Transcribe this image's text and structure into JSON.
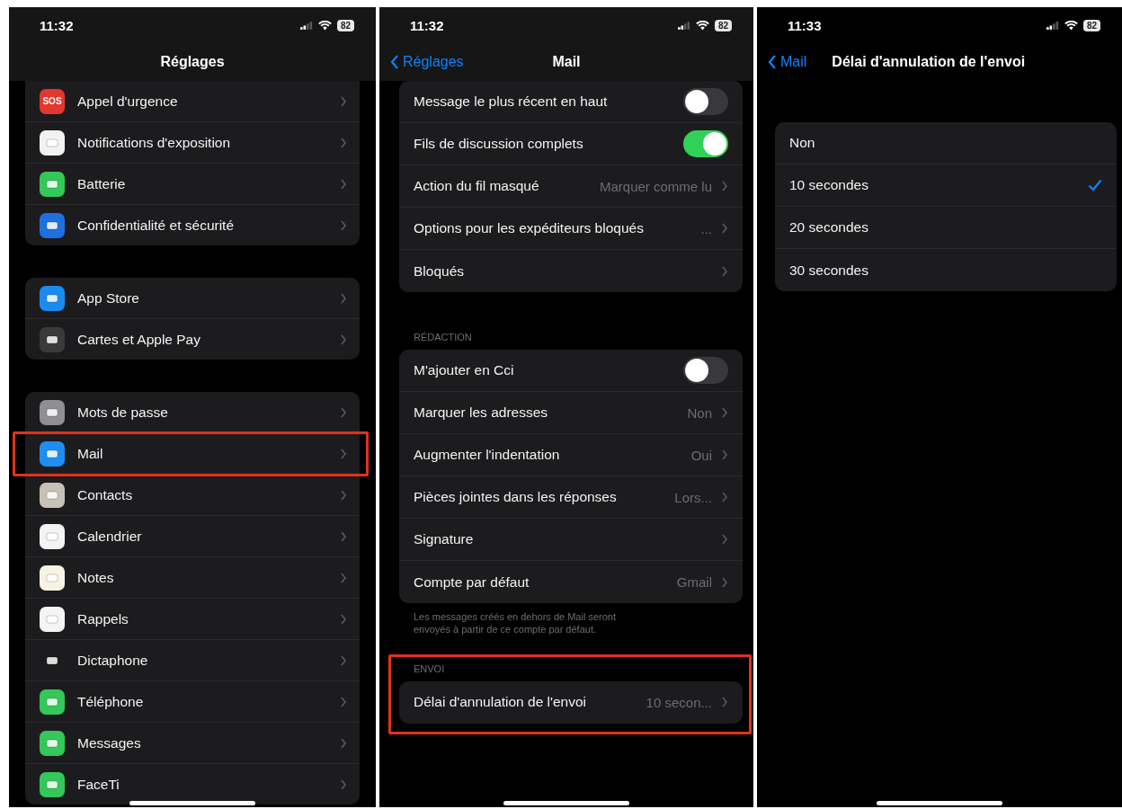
{
  "screens": [
    {
      "status": {
        "time": "11:32",
        "battery": "82"
      },
      "nav": {
        "title": "Réglages"
      },
      "groups": [
        {
          "items": [
            {
              "label": "Appel d'urgence",
              "color": "#e5372f",
              "icon_text": "SOS",
              "highlighted": false
            },
            {
              "label": "Notifications d'exposition",
              "color": "#f2f2f2",
              "highlighted": false
            },
            {
              "label": "Batterie",
              "color": "#34c759",
              "highlighted": false
            },
            {
              "label": "Confidentialité et sécurité",
              "color": "#1e6fe0",
              "highlighted": false
            }
          ]
        },
        {
          "items": [
            {
              "label": "App Store",
              "color": "#1a8cf0",
              "highlighted": false
            },
            {
              "label": "Cartes et Apple Pay",
              "color": "#3a3a3a",
              "highlighted": false
            }
          ]
        },
        {
          "items": [
            {
              "label": "Mots de passe",
              "color": "#8e8e93",
              "highlighted": false
            },
            {
              "label": "Mail",
              "color": "#1f8ef1",
              "highlighted": true
            },
            {
              "label": "Contacts",
              "color": "#c7c2b8",
              "highlighted": false
            },
            {
              "label": "Calendrier",
              "color": "#f4f4f4",
              "highlighted": false
            },
            {
              "label": "Notes",
              "color": "#f7f3e3",
              "highlighted": false
            },
            {
              "label": "Rappels",
              "color": "#f4f4f4",
              "highlighted": false
            },
            {
              "label": "Dictaphone",
              "color": "#1c1c1e",
              "highlighted": false
            },
            {
              "label": "Téléphone",
              "color": "#34c759",
              "highlighted": false
            },
            {
              "label": "Messages",
              "color": "#34c759",
              "highlighted": false
            },
            {
              "label": "FaceTi",
              "color": "#34c759",
              "highlighted": false
            }
          ]
        }
      ]
    },
    {
      "status": {
        "time": "11:32",
        "battery": "82"
      },
      "nav": {
        "back": "Réglages",
        "title": "Mail"
      },
      "groups": [
        {
          "items": [
            {
              "kind": "toggle",
              "label": "Message le plus récent en haut",
              "on": false
            },
            {
              "kind": "toggle",
              "label": "Fils de discussion complets",
              "on": true
            },
            {
              "kind": "disclosure",
              "label": "Action du fil masqué",
              "value": "Marquer comme lu"
            },
            {
              "kind": "disclosure",
              "label": "Options pour les expéditeurs bloqués",
              "value": "..."
            },
            {
              "kind": "disclosure",
              "label": "Bloqués"
            }
          ]
        },
        {
          "header": "RÉDACTION",
          "highlighted": false,
          "footer": "Les messages créés en dehors de Mail seront envoyés à partir de ce compte par défaut.",
          "items": [
            {
              "kind": "toggle",
              "label": "M'ajouter en Cci",
              "on": false
            },
            {
              "kind": "disclosure",
              "label": "Marquer les adresses",
              "value": "Non"
            },
            {
              "kind": "disclosure",
              "label": "Augmenter l'indentation",
              "value": "Oui"
            },
            {
              "kind": "disclosure",
              "label": "Pièces jointes dans les réponses",
              "value": "Lors..."
            },
            {
              "kind": "disclosure",
              "label": "Signature"
            },
            {
              "kind": "disclosure",
              "label": "Compte par défaut",
              "value": "Gmail"
            }
          ]
        },
        {
          "header": "ENVOI",
          "highlighted": true,
          "items": [
            {
              "kind": "disclosure",
              "label": "Délai d'annulation de l'envoi",
              "value": "10 secon..."
            }
          ]
        }
      ]
    },
    {
      "status": {
        "time": "11:33",
        "battery": "82"
      },
      "nav": {
        "back": "Mail",
        "title": "Délai d'annulation de l'envoi"
      },
      "options": [
        {
          "label": "Non",
          "selected": false
        },
        {
          "label": "10 secondes",
          "selected": true
        },
        {
          "label": "20 secondes",
          "selected": false
        },
        {
          "label": "30 secondes",
          "selected": false
        }
      ]
    }
  ]
}
